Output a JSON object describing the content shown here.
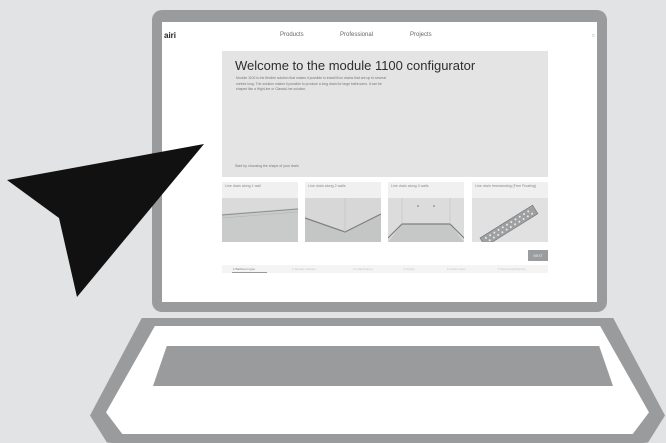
{
  "website": {
    "logo": "airi",
    "nav": [
      "Products",
      "Professional",
      "Projects"
    ],
    "search_icon": "search-icon",
    "hero": {
      "title": "Welcome to the module 1100 configurator",
      "description": "Module 1100 is the flexible solution that makes it possible to install floor drains that are up to several metres long. The solution makes it possible to produce a long drain for large bathrooms. It can be shaped like a HighLine or ClassicLine solution.",
      "hint": "Start by choosing the shape of your drain"
    },
    "options": [
      {
        "label": "Line drain along 1 wall"
      },
      {
        "label": "Line drain along 2 walls"
      },
      {
        "label": "Line drain along 3 walls"
      },
      {
        "label": "Line drain freestanding (Free Floating)"
      }
    ],
    "next_button": "NEXT",
    "steps": [
      "1 Bathroom type",
      "2 Shower solution",
      "3 Grate/Frame",
      "4 Design",
      "5 Outlet cover",
      "6 Summary/Ordering"
    ]
  },
  "colors": {
    "device": "#9a9b9d",
    "background": "#e2e3e5",
    "arrow": "#111111"
  }
}
